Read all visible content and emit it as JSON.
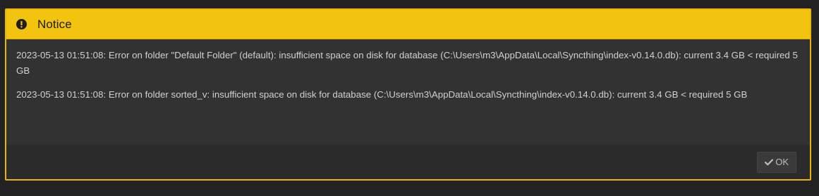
{
  "dialog": {
    "title": "Notice",
    "icon": "exclamation-circle-icon",
    "accent_color": "#f2c30f"
  },
  "messages": [
    "2023-05-13 01:51:08: Error on folder \"Default Folder\" (default): insufficient space on disk for database (C:\\Users\\m3\\AppData\\Local\\Syncthing\\index-v0.14.0.db): current 3.4 GB < required 5 GB",
    "2023-05-13 01:51:08: Error on folder sorted_v: insufficient space on disk for database (C:\\Users\\m3\\AppData\\Local\\Syncthing\\index-v0.14.0.db): current 3.4 GB < required 5 GB"
  ],
  "footer": {
    "ok_label": "OK",
    "ok_icon": "check-icon"
  }
}
